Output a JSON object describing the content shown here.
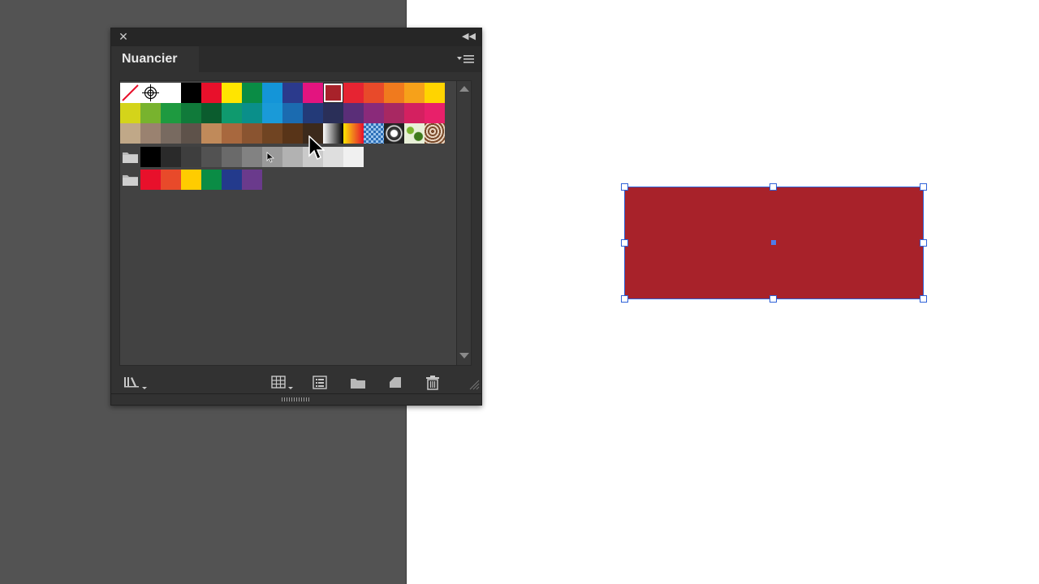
{
  "panel": {
    "tab_label": "Nuancier"
  },
  "swatches": {
    "row1": [
      "none",
      "registration",
      "#ffffff",
      "#000000",
      "#e8102b",
      "#ffe500",
      "#0a8c45",
      "#1495d8",
      "#2b3a8c",
      "#e3147f",
      "#a8222a",
      "#e62432",
      "#e84a2a",
      "#f07a1e",
      "#f6a11a",
      "#ffd400"
    ],
    "row2": [
      "#d4d41a",
      "#78b32e",
      "#1e9a40",
      "#107a3a",
      "#0b5c2e",
      "#0f9a6e",
      "#0a8f8a",
      "#1a9ad8",
      "#1b6bb0",
      "#233a78",
      "#2a2f58",
      "#5a2e78",
      "#8a2a7a",
      "#a82862",
      "#d42060",
      "#e8206a"
    ],
    "row3": [
      "#c0a888",
      "#9a8270",
      "#786a60",
      "#5e524a",
      "#c08a5a",
      "#a8683e",
      "#8a5430",
      "#704422",
      "#583418",
      "#3c2a1c",
      "gradient-bw",
      "gradient-orange",
      "pattern-blue",
      "pattern-bubble",
      "pattern-leaf",
      "pattern-swirl"
    ],
    "group1": [
      "#000000",
      "#2a2a2a",
      "#3e3e3e",
      "#525252",
      "#6a6a6a",
      "#828282",
      "#9a9a9a",
      "#b2b2b2",
      "#cacaca",
      "#dedede",
      "#f0f0f0"
    ],
    "group2": [
      "#e8102b",
      "#e84a2a",
      "#ffcc00",
      "#0a8c45",
      "#233a8c",
      "#6a3a8c"
    ]
  },
  "artwork": {
    "fill_color": "#a8222a",
    "selection_color": "#2f62d8"
  }
}
